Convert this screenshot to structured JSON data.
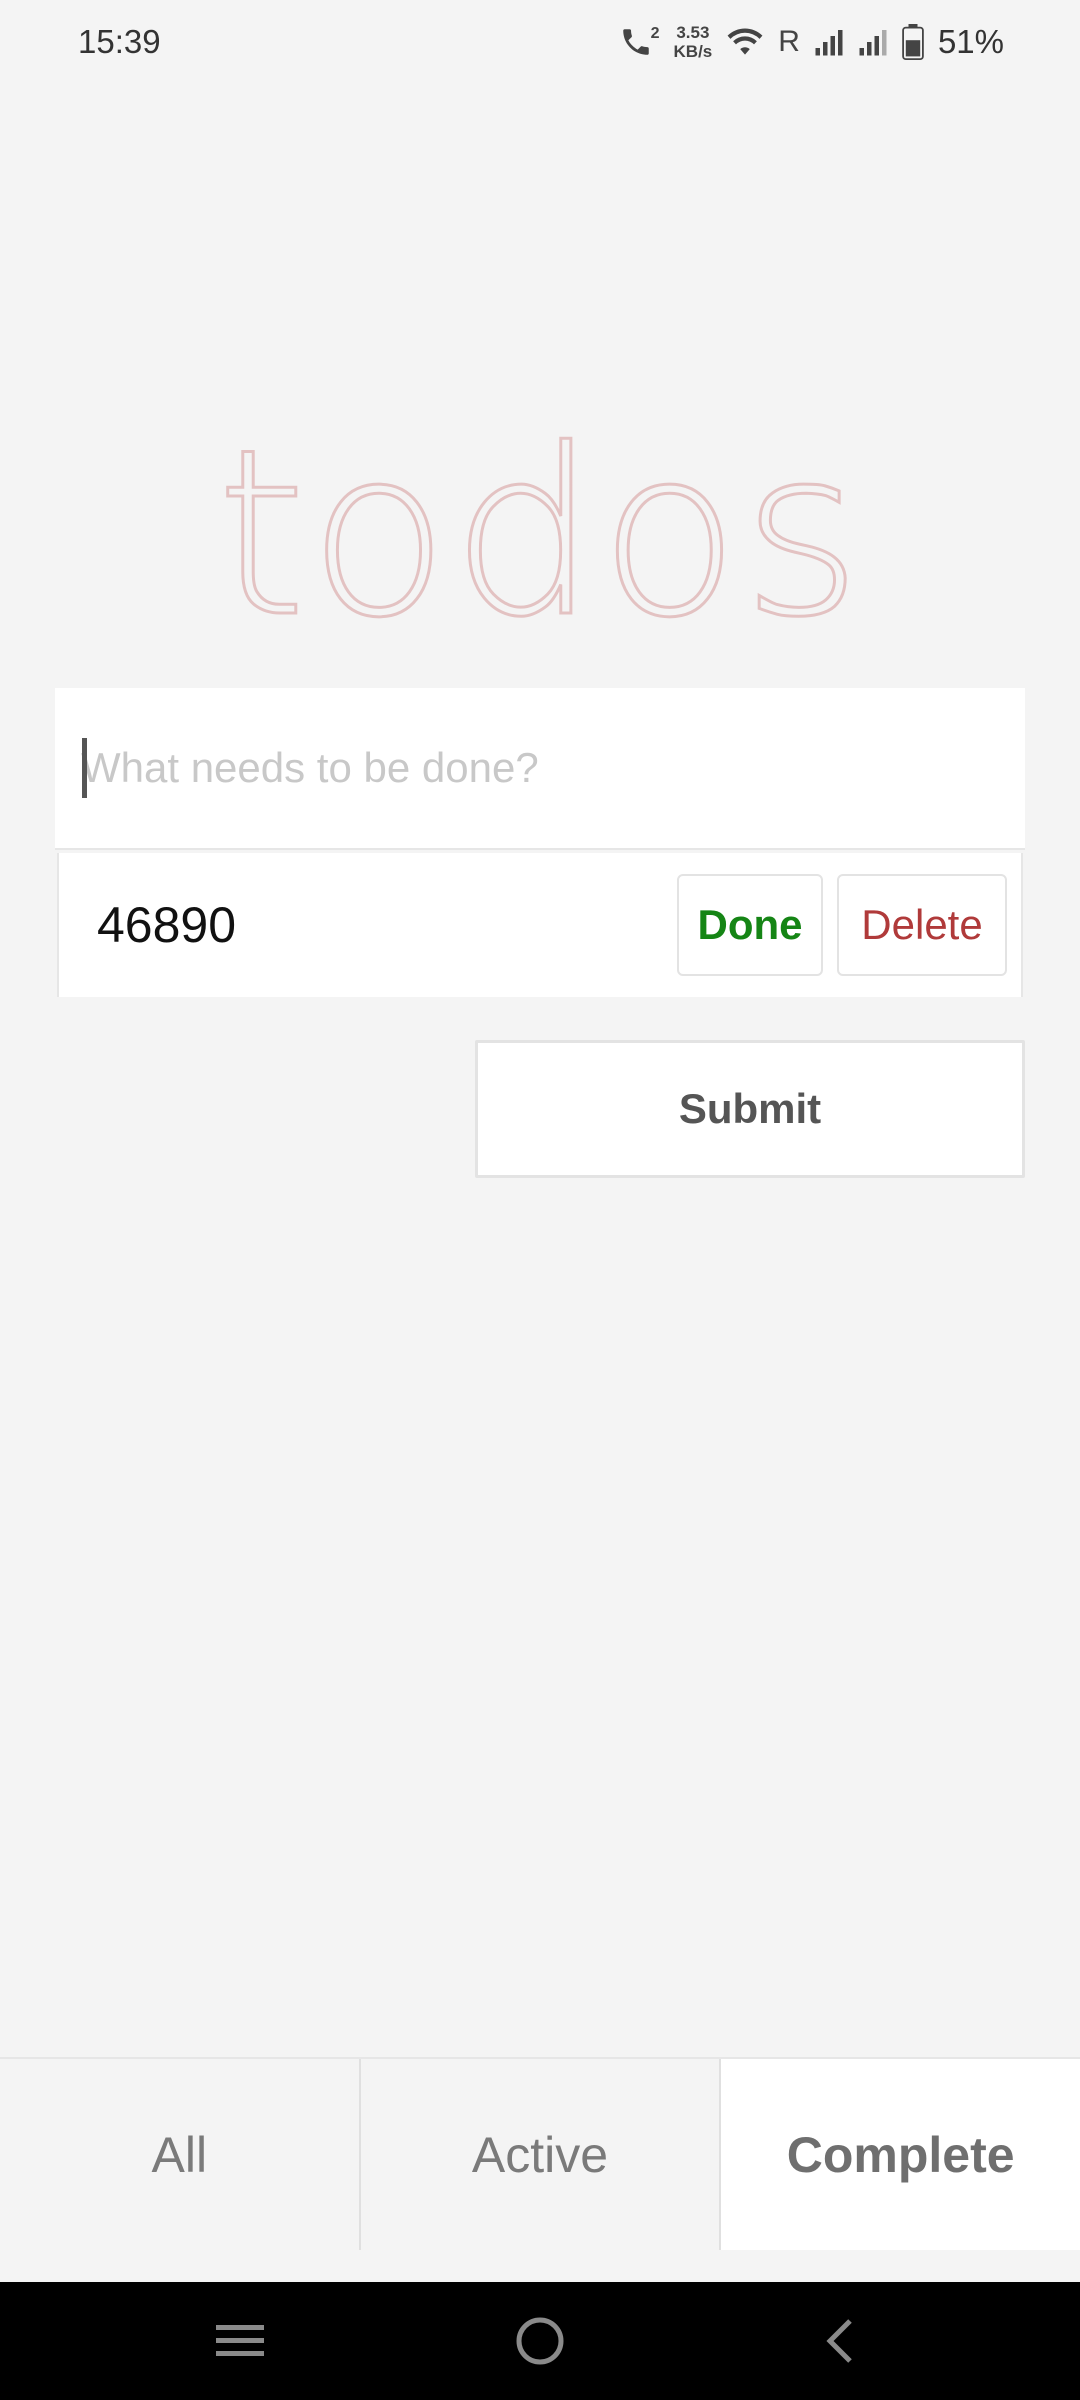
{
  "status_bar": {
    "time": "15:39",
    "net_speed_value": "3.53",
    "net_speed_unit": "KB/s",
    "call_badge": "2",
    "roaming": "R",
    "battery": "51%"
  },
  "app": {
    "title": "todos"
  },
  "new_todo": {
    "placeholder": "What needs to be done?",
    "value": ""
  },
  "todos": [
    {
      "text": "46890",
      "done_label": "Done",
      "delete_label": "Delete"
    }
  ],
  "submit_label": "Submit",
  "filters": {
    "items": [
      "All",
      "Active",
      "Complete"
    ],
    "selected": "Complete"
  },
  "colors": {
    "title": "#e3c2c2",
    "done": "#158515",
    "delete": "#b03a3a",
    "background": "#f4f4f4"
  },
  "nav_icons": [
    "menu-icon",
    "home-icon",
    "back-icon"
  ]
}
